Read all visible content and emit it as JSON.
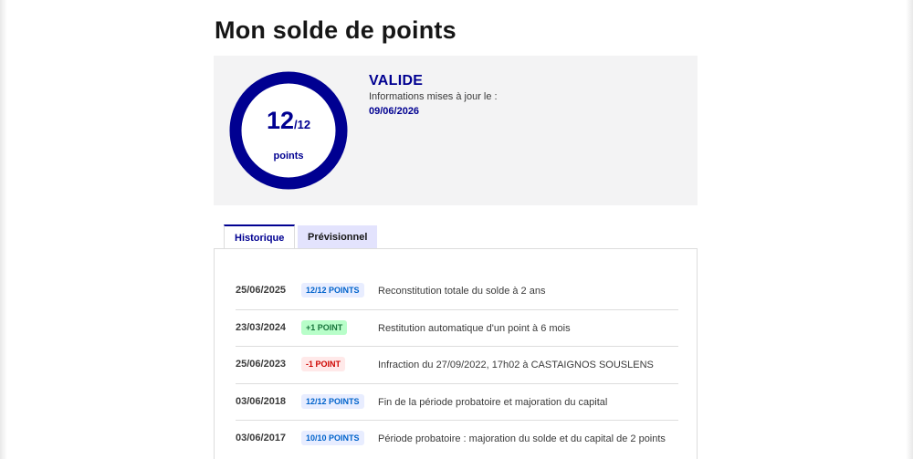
{
  "page": {
    "title": "Mon solde de points"
  },
  "balance": {
    "points": "12",
    "max": "/12",
    "unit": "points",
    "fill_fraction": 1.0,
    "ring_color": "#000091",
    "status": "VALIDE",
    "info_label": "Informations mises à jour le :",
    "info_date": "09/06/2026"
  },
  "tabs": [
    {
      "label": "Historique",
      "active": true
    },
    {
      "label": "Prévisionnel",
      "active": false
    }
  ],
  "history": [
    {
      "date": "25/06/2025",
      "badge": "12/12 POINTS",
      "badge_type": "info",
      "description": "Reconstitution totale du solde à 2 ans"
    },
    {
      "date": "23/03/2024",
      "badge": "+1 POINT",
      "badge_type": "success",
      "description": "Restitution automatique d'un point à 6 mois"
    },
    {
      "date": "25/06/2023",
      "badge": "-1 POINT",
      "badge_type": "error",
      "description": "Infraction du 27/09/2022, 17h02 à CASTAIGNOS SOUSLENS"
    },
    {
      "date": "03/06/2018",
      "badge": "12/12 POINTS",
      "badge_type": "info",
      "description": "Fin de la période probatoire et majoration du capital"
    },
    {
      "date": "03/06/2017",
      "badge": "10/10 POINTS",
      "badge_type": "info",
      "description": "Période probatoire : majoration du solde et du capital de 2 points"
    }
  ]
}
